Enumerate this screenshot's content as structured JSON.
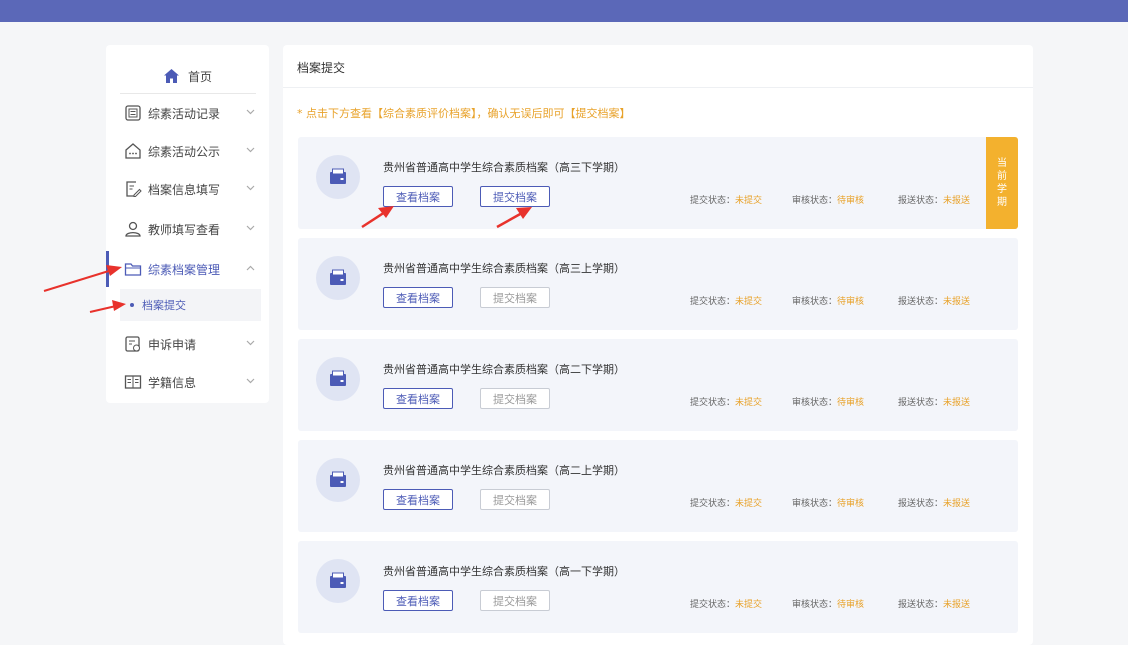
{
  "sidebar": {
    "home_label": "首页",
    "items": [
      {
        "label": "综素活动记录"
      },
      {
        "label": "综素活动公示"
      },
      {
        "label": "档案信息填写"
      },
      {
        "label": "教师填写查看"
      },
      {
        "label": "综素档案管理"
      },
      {
        "label": "申诉申请"
      },
      {
        "label": "学籍信息"
      }
    ],
    "sub_item_label": "档案提交"
  },
  "main": {
    "title": "档案提交",
    "notice": "* 点击下方查看【综合素质评价档案】，确认无误后即可【提交档案】",
    "view_label": "查看档案",
    "submit_label": "提交档案",
    "status_labels": {
      "submit": "提交状态：",
      "review": "审核状态：",
      "report": "报送状态："
    },
    "current_badge": [
      "当",
      "前",
      "学",
      "期"
    ],
    "cards": [
      {
        "title": "贵州省普通高中学生综合素质档案（高三下学期）",
        "submit_status": "未提交",
        "review_status": "待审核",
        "report_status": "未报送"
      },
      {
        "title": "贵州省普通高中学生综合素质档案（高三上学期）",
        "submit_status": "未提交",
        "review_status": "待审核",
        "report_status": "未报送"
      },
      {
        "title": "贵州省普通高中学生综合素质档案（高二下学期）",
        "submit_status": "未提交",
        "review_status": "待审核",
        "report_status": "未报送"
      },
      {
        "title": "贵州省普通高中学生综合素质档案（高二上学期）",
        "submit_status": "未提交",
        "review_status": "待审核",
        "report_status": "未报送"
      },
      {
        "title": "贵州省普通高中学生综合素质档案（高一下学期）",
        "submit_status": "未提交",
        "review_status": "待审核",
        "report_status": "未报送"
      }
    ]
  },
  "colors": {
    "primary": "#4c5bb6",
    "warning": "#e8a22a",
    "badge": "#f3b12e",
    "topbar": "#5b68b8"
  }
}
